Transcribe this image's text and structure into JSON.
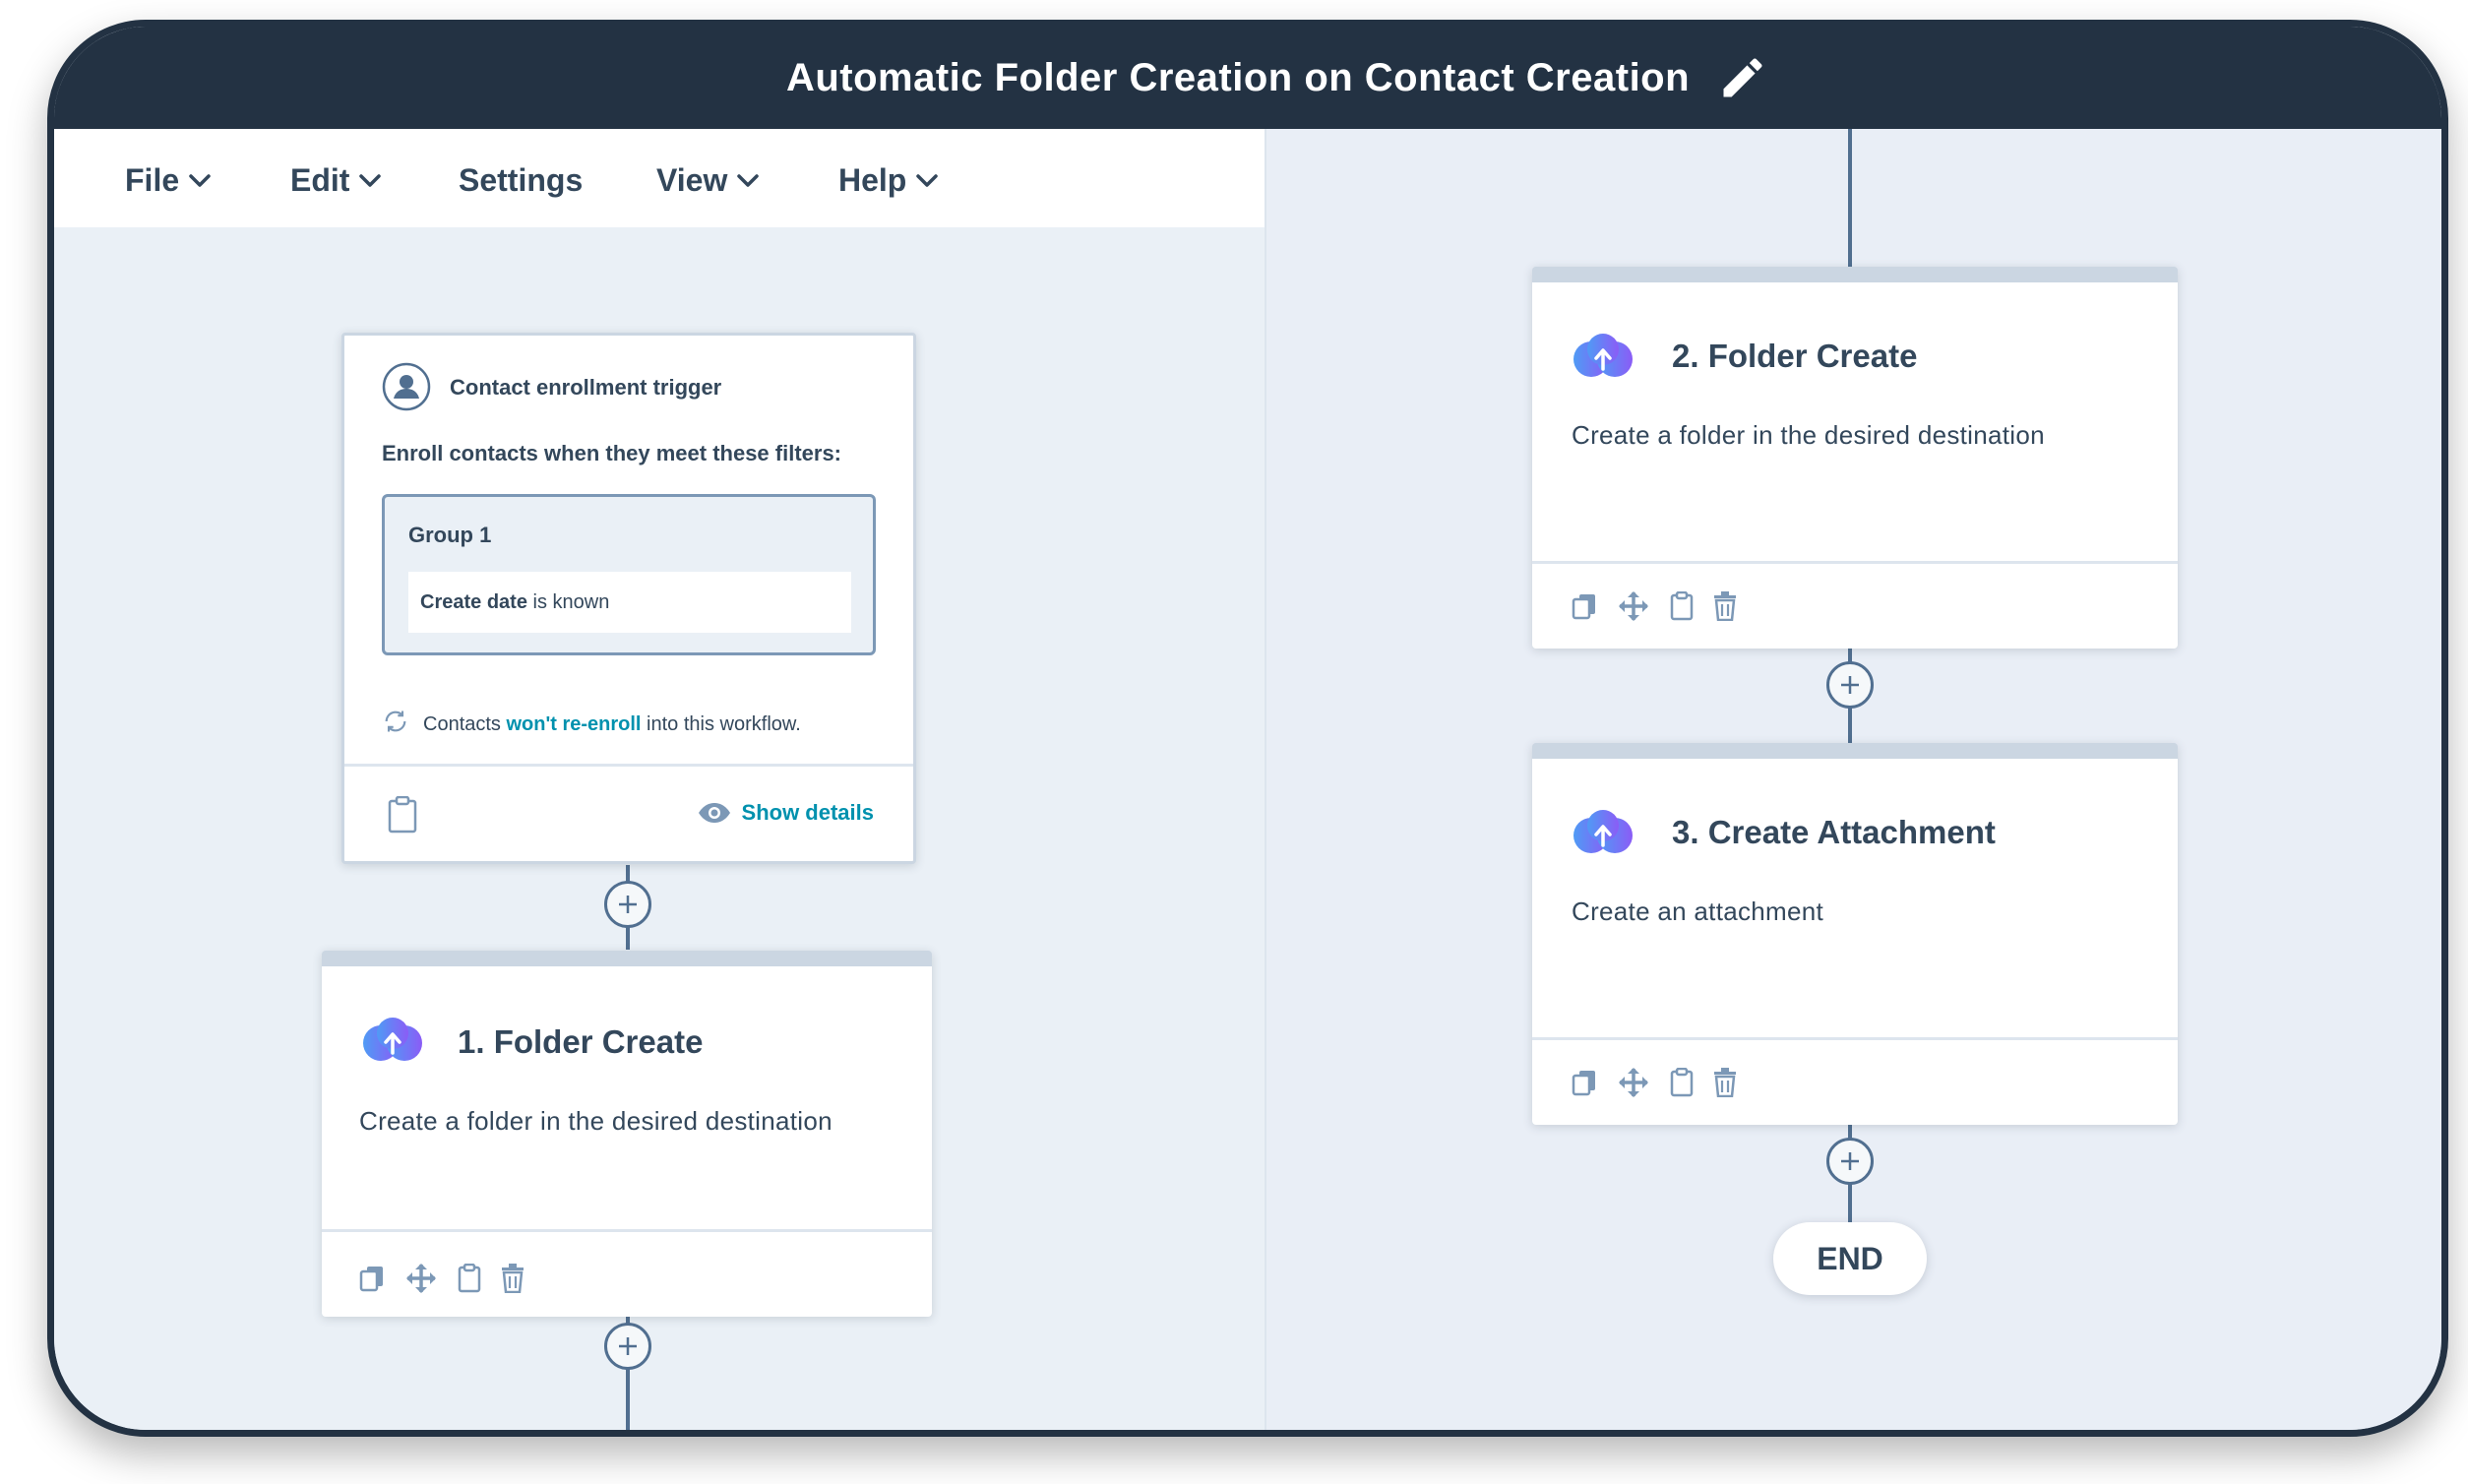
{
  "window": {
    "title": "Automatic Folder Creation on Contact Creation"
  },
  "menu": {
    "file": "File",
    "edit": "Edit",
    "settings": "Settings",
    "view": "View",
    "help": "Help"
  },
  "trigger": {
    "title": "Contact enrollment trigger",
    "filters_heading": "Enroll contacts when they meet these filters:",
    "group_label": "Group 1",
    "filter_property": "Create date",
    "filter_condition": "is known",
    "reenroll_prefix": "Contacts",
    "reenroll_link": "won't re-enroll",
    "reenroll_suffix": "into this workflow.",
    "show_details": "Show details"
  },
  "actions": [
    {
      "title": "1. Folder Create",
      "description": "Create a folder in the desired destination"
    },
    {
      "title": "2. Folder Create",
      "description": "Create a folder in the desired destination"
    },
    {
      "title": "3. Create Attachment",
      "description": "Create an attachment"
    }
  ],
  "end_label": "END",
  "colors": {
    "titlebar": "#233243",
    "canvas": "#eaf0f6",
    "link": "#0091ae",
    "connector": "#516f90",
    "cloud_start": "#4f9bf5",
    "cloud_end": "#8b5cf6"
  }
}
